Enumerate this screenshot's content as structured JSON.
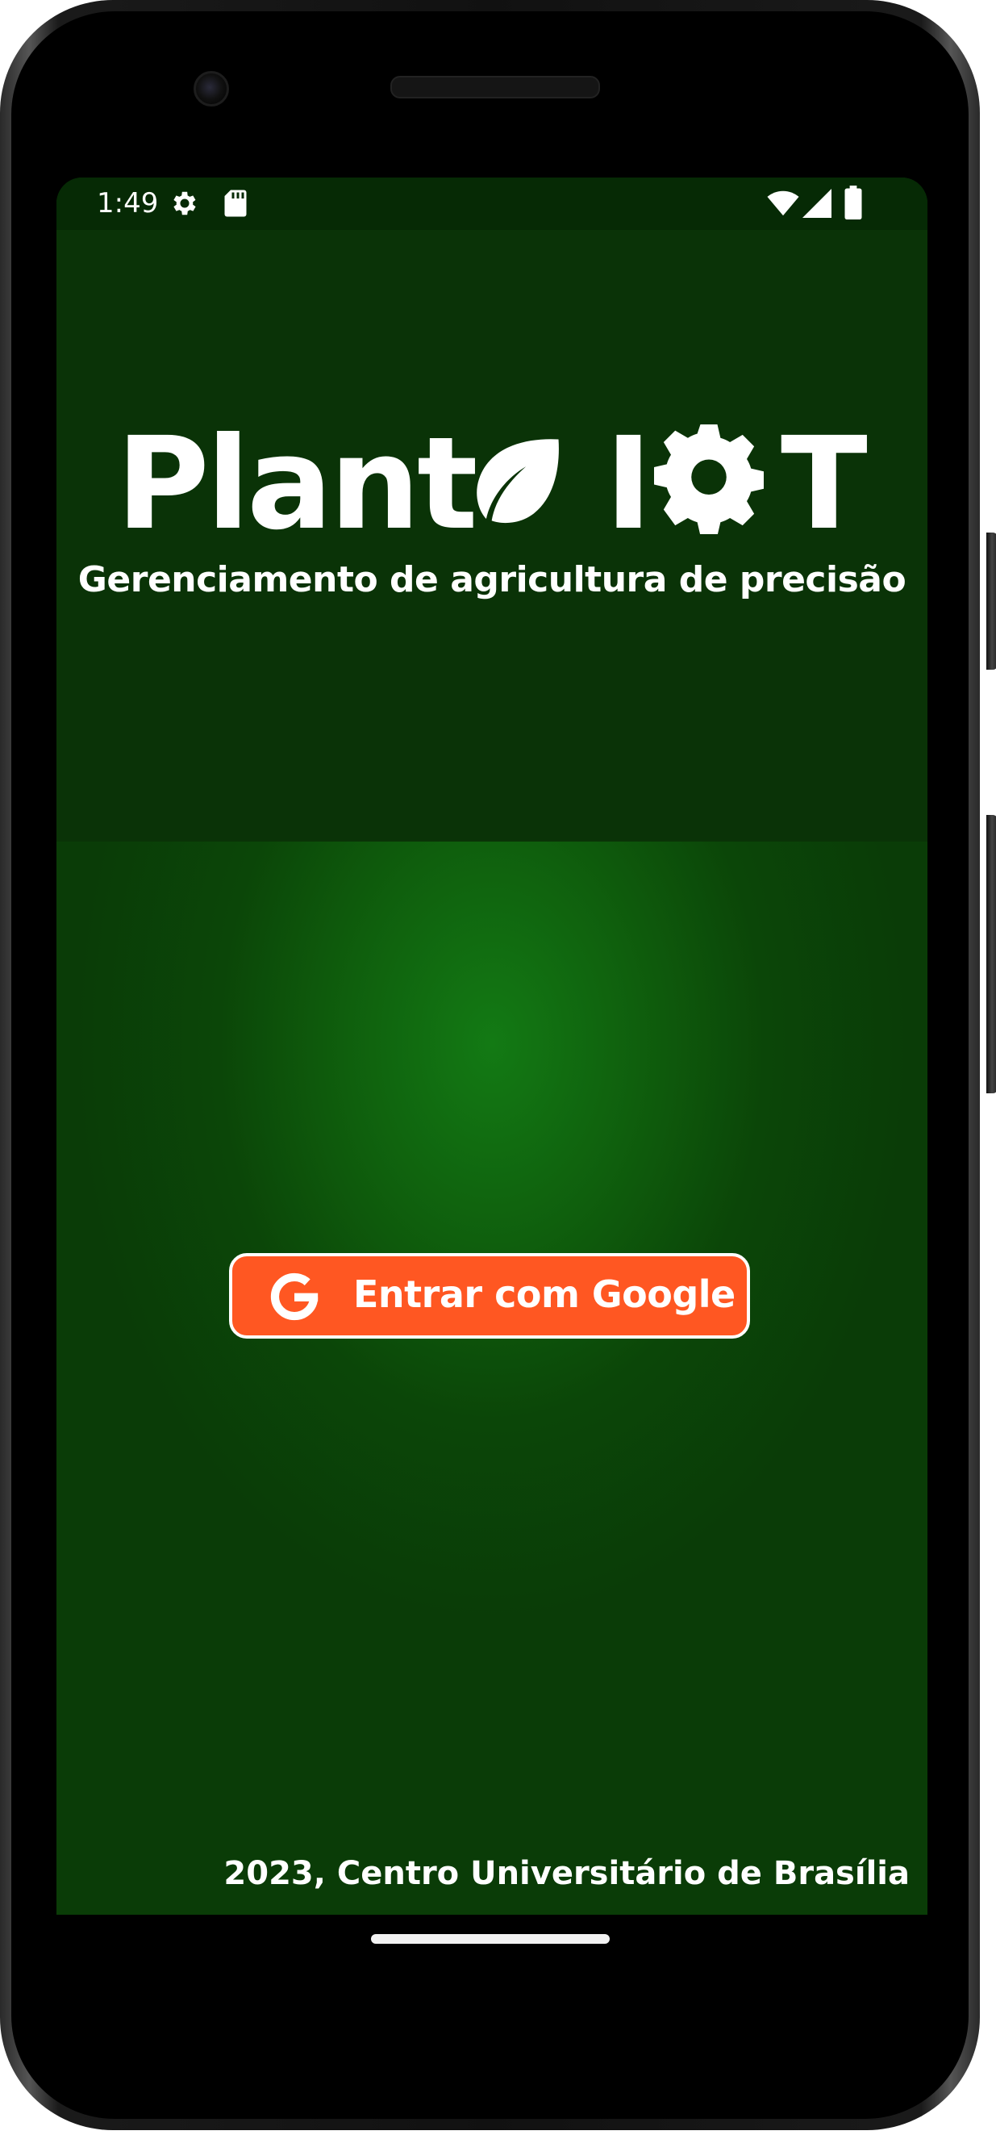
{
  "status_bar": {
    "time": "1:49",
    "left_icons": [
      "settings-icon",
      "sd-card-icon"
    ],
    "right_icons": [
      "wifi-icon",
      "cell-signal-icon",
      "battery-icon"
    ]
  },
  "header": {
    "brand_word1": "Plant",
    "brand_word2_a": "I",
    "brand_word2_b": "T",
    "brand_icons": [
      "leaf-icon",
      "gear-icon"
    ],
    "subtitle": "Gerenciamento de agricultura de precisão"
  },
  "login": {
    "button_label": "Entrar com Google",
    "button_icon": "google-g-icon"
  },
  "footer": {
    "text": "2023, Centro Universitário de Brasília"
  },
  "colors": {
    "header_bg": "#0a3307",
    "main_bg_center": "#137a14",
    "button_bg": "#ff5722",
    "text": "#ffffff"
  }
}
